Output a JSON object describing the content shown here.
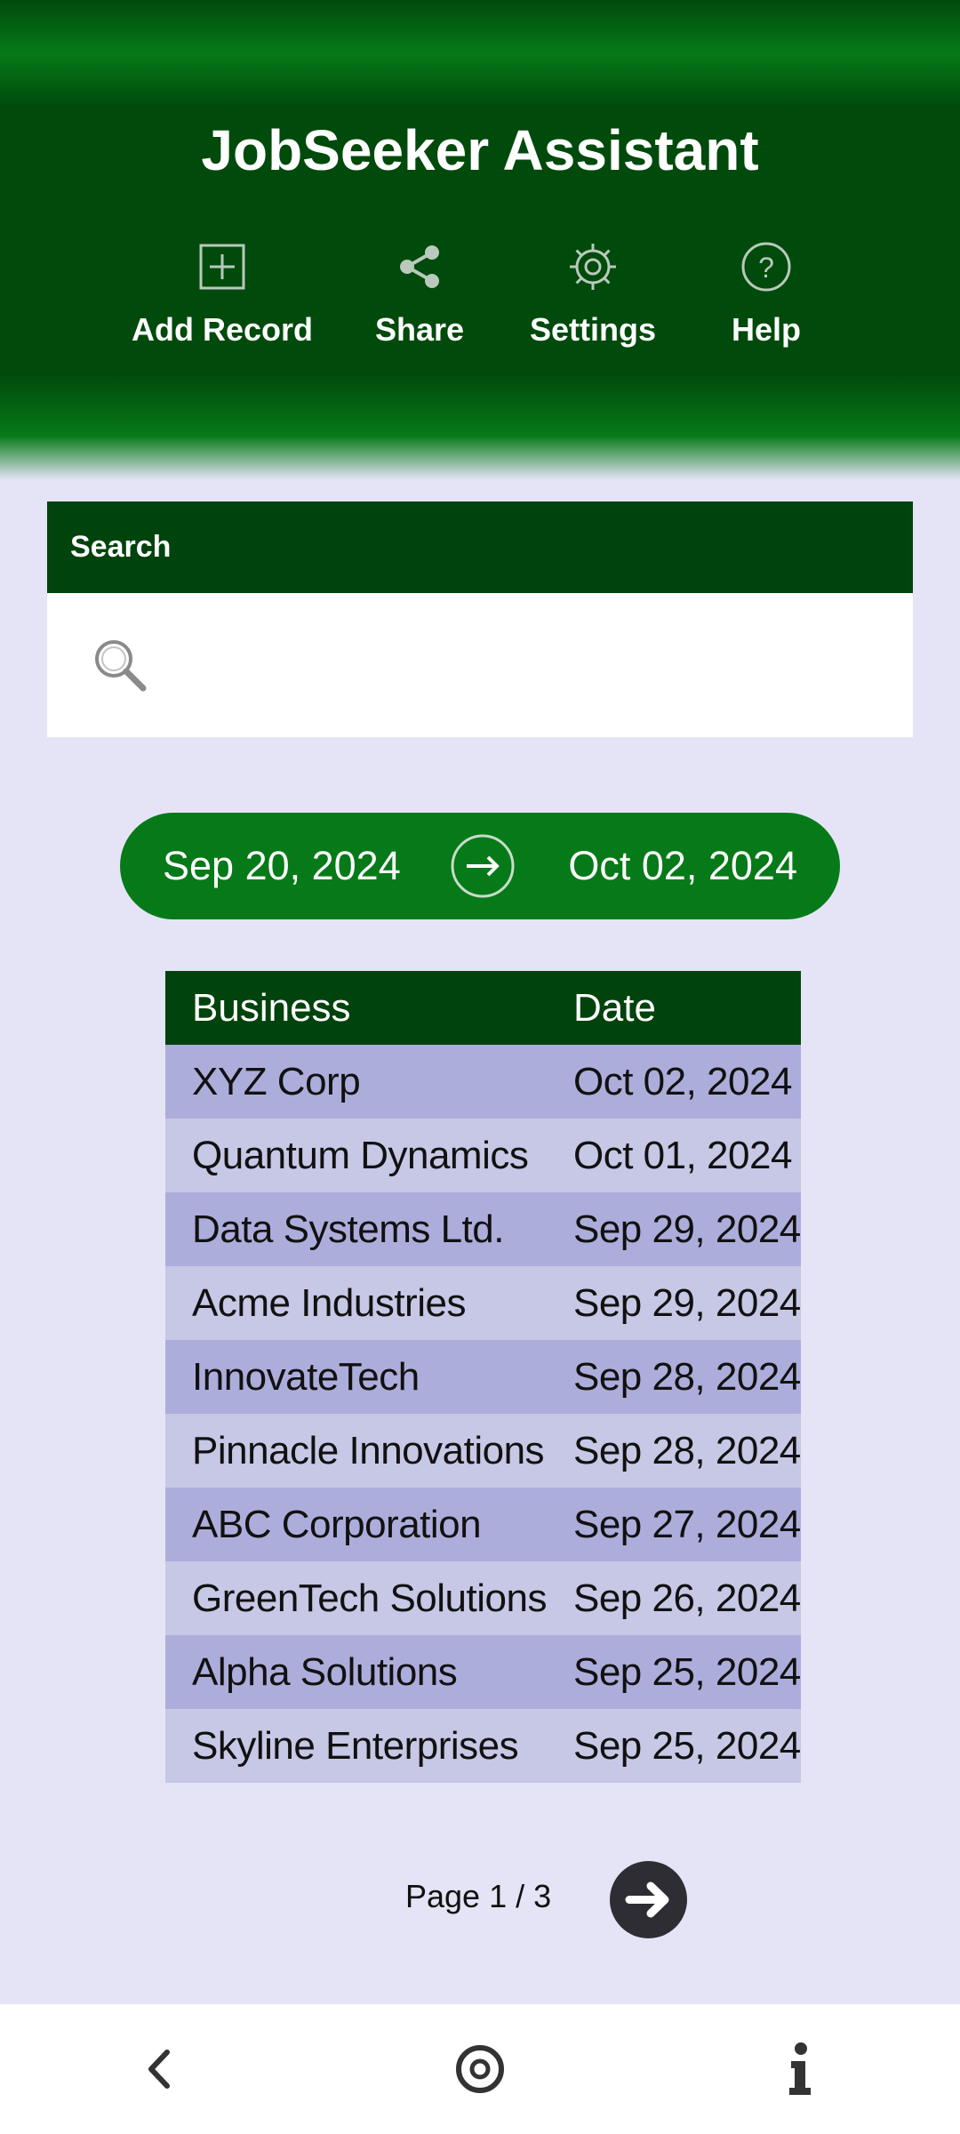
{
  "header": {
    "title": "JobSeeker Assistant",
    "actions": [
      {
        "label": "Add Record",
        "icon": "add-square-icon"
      },
      {
        "label": "Share",
        "icon": "share-icon"
      },
      {
        "label": "Settings",
        "icon": "gear-icon"
      },
      {
        "label": "Help",
        "icon": "help-circle-icon"
      }
    ]
  },
  "search": {
    "heading": "Search",
    "value": "",
    "placeholder": ""
  },
  "date_range": {
    "start": "Sep 20, 2024",
    "end": "Oct 02, 2024"
  },
  "table": {
    "columns": [
      "Business",
      "Date"
    ],
    "rows": [
      {
        "business": "XYZ Corp",
        "date": "Oct 02, 2024"
      },
      {
        "business": "Quantum Dynamics",
        "date": "Oct 01, 2024"
      },
      {
        "business": "Data Systems Ltd.",
        "date": "Sep 29, 2024"
      },
      {
        "business": "Acme Industries",
        "date": "Sep 29, 2024"
      },
      {
        "business": "InnovateTech",
        "date": "Sep 28, 2024"
      },
      {
        "business": "Pinnacle Innovations",
        "date": "Sep 28, 2024"
      },
      {
        "business": "ABC Corporation",
        "date": "Sep 27, 2024"
      },
      {
        "business": "GreenTech Solutions",
        "date": "Sep 26, 2024"
      },
      {
        "business": "Alpha Solutions",
        "date": "Sep 25, 2024"
      },
      {
        "business": "Skyline Enterprises",
        "date": "Sep 25, 2024"
      }
    ]
  },
  "pager": {
    "label": "Page 1 / 3"
  },
  "nav": {
    "icons": [
      "back-icon",
      "home-icon",
      "info-icon"
    ]
  },
  "colors": {
    "header_green": "#004a0c",
    "accent_green": "#067a18",
    "background": "#e4e4f6",
    "row_odd": "#adaddc",
    "row_even": "#c7c7e6"
  }
}
